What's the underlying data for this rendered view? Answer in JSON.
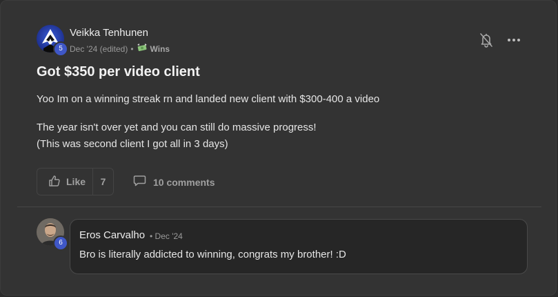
{
  "post": {
    "author": {
      "name": "Veikka Tenhunen",
      "level": "5",
      "avatar_icon": "spy-figure-icon"
    },
    "meta": {
      "date": "Dec '24 (edited)",
      "separator": "•",
      "category_icon": "flying-money-icon",
      "category": "Wins"
    },
    "title": "Got $350 per video client",
    "body": [
      "Yoo Im on a winning streak rn and landed new client with $300-400 a video",
      "The year isn't over yet and you can still do massive progress!",
      "(This was second client I got all in 3 days)"
    ],
    "actions": {
      "like_label": "Like",
      "like_count": "7",
      "comments_label": "10 comments"
    }
  },
  "comment": {
    "author": "Eros Carvalho",
    "level": "6",
    "date": "• Dec '24",
    "text": "Bro is literally addicted to winning, congrats my brother! :D"
  },
  "colors": {
    "card_bg": "#333333",
    "bubble_bg": "#262626",
    "level_badge": "#3f57c7",
    "muted_text": "#a0a0a0"
  }
}
